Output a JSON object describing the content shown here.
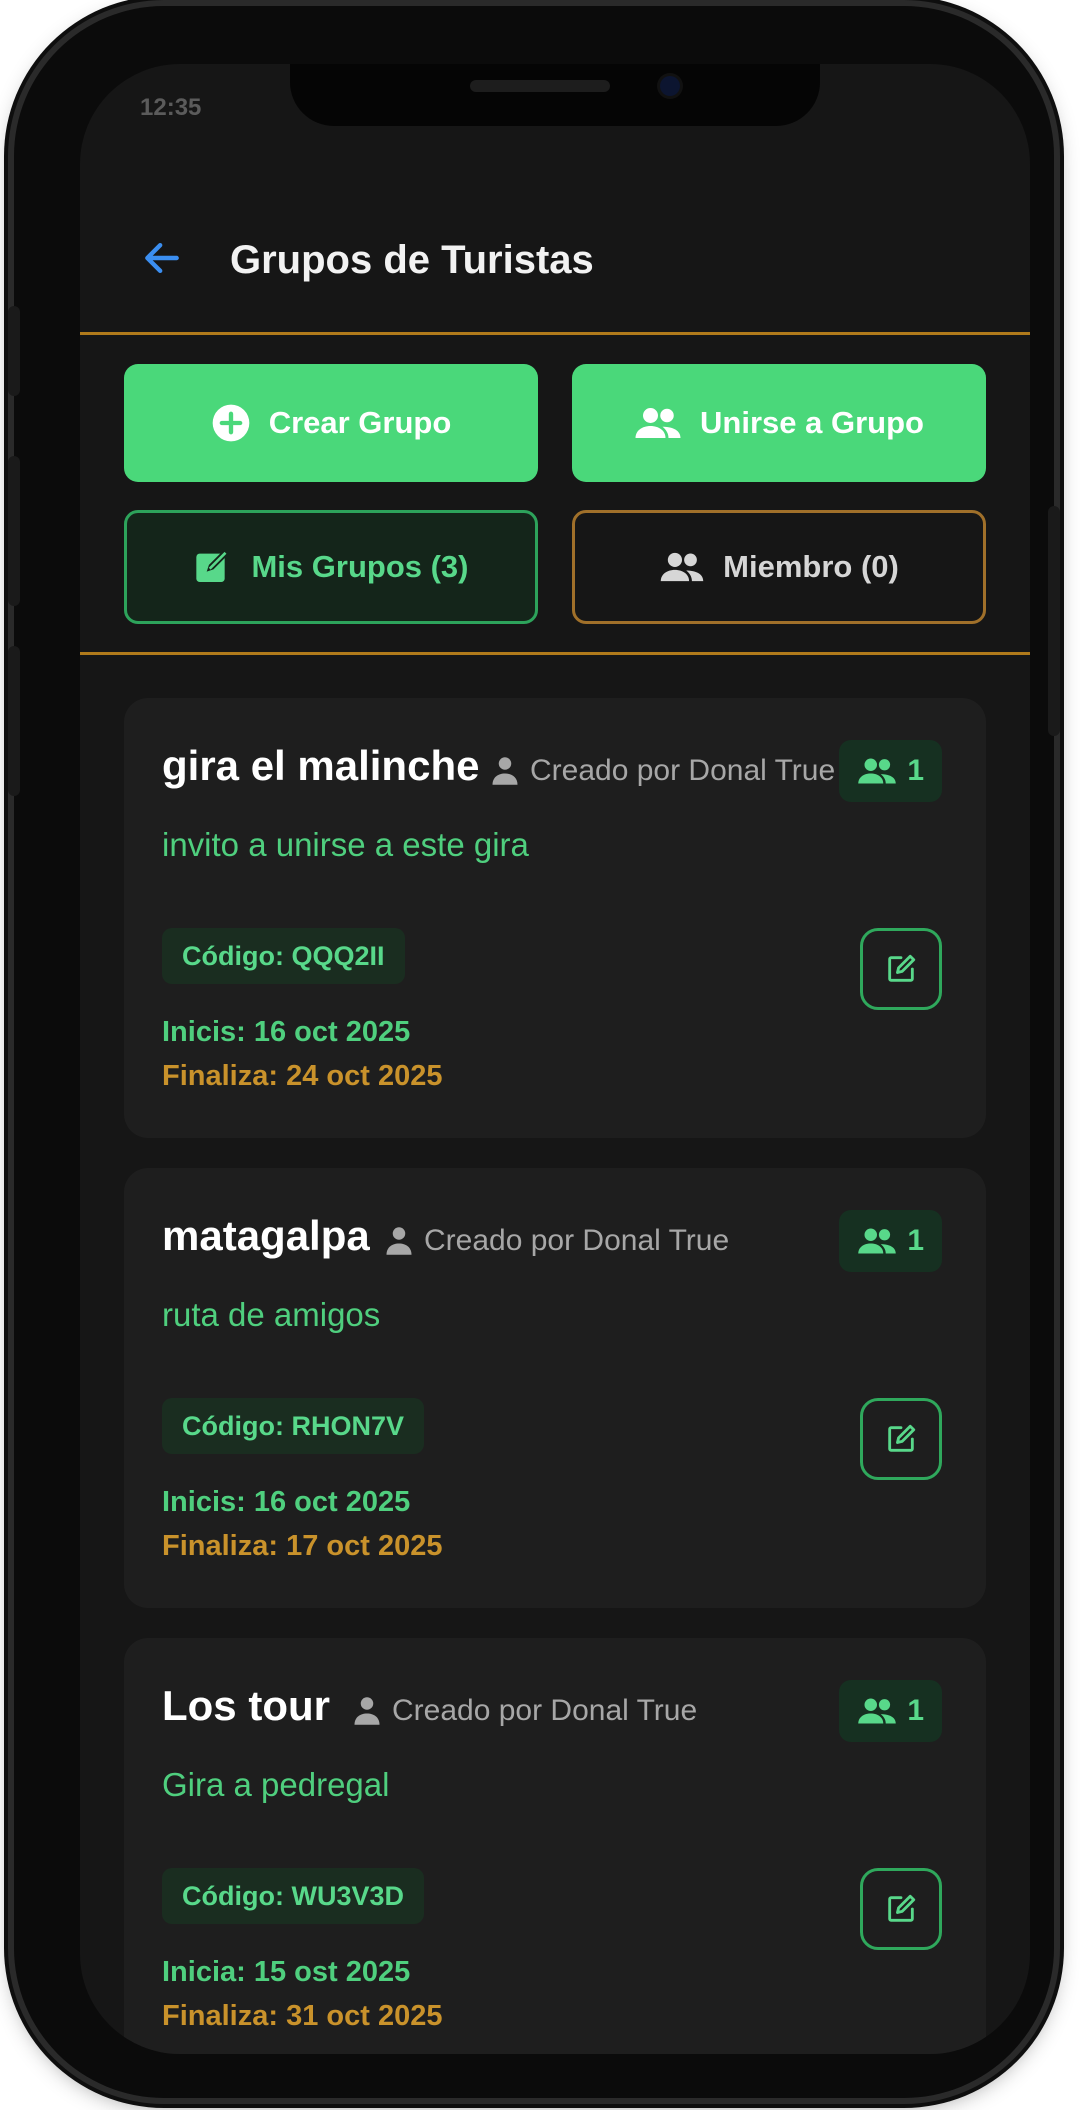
{
  "status_bar": {
    "time": "12:35",
    "right": ""
  },
  "header": {
    "title": "Grupos de Turistas",
    "back_icon": "arrow-left-icon"
  },
  "actions": {
    "create_label": "Crear Grupo",
    "join_label": "Unirse a Grupo"
  },
  "tabs": {
    "mine_label": "Mis Grupos (3)",
    "member_label": "Miembro (0)"
  },
  "groups": [
    {
      "name": "gira el malinche",
      "creator": "Creado por Donal True",
      "members": "1",
      "description": "invito a unirse a este gira",
      "code": "Código: QQQ2II",
      "start": "Inicis: 16 oct 2025",
      "end": "Finaliza: 24 oct 2025"
    },
    {
      "name": "matagalpa",
      "creator": "Creado por Donal True",
      "members": "1",
      "description": "ruta de amigos",
      "code": "Código: RHON7V",
      "start": "Inicis: 16 oct 2025",
      "end": "Finaliza: 17 oct 2025"
    },
    {
      "name": "Los tour",
      "creator": "Creado por Donal True",
      "members": "1",
      "description": "Gira a pedregal",
      "code": "Código: WU3V3D",
      "start": "Inicia: 15 ost 2025",
      "end": "Finaliza: 31 oct 2025"
    }
  ],
  "colors": {
    "accent_green": "#4ad87a",
    "gold": "#c9922b",
    "background": "#161616",
    "card": "#1e1e1e"
  }
}
